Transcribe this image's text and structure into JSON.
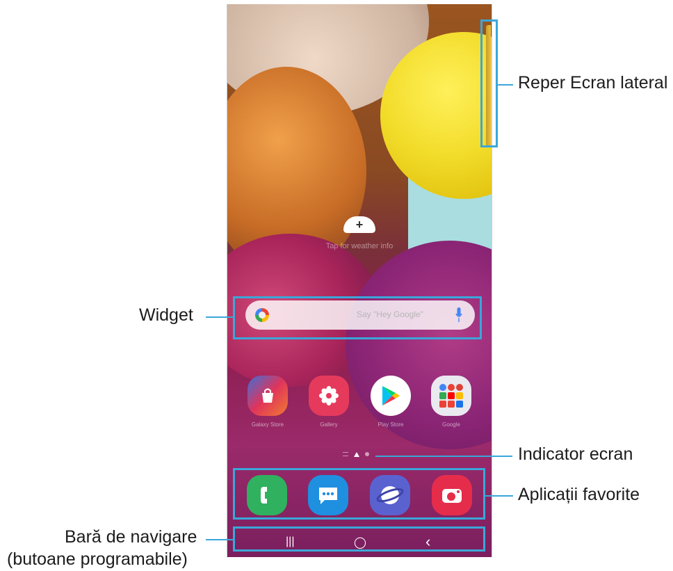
{
  "search_widget": {
    "hint": "Say \"Hey Google\""
  },
  "weather_widget": {
    "hint": "Tap for weather info"
  },
  "apps": [
    {
      "label": "Galaxy Store",
      "icon": "shopping-bag-icon",
      "color": "#e8434c"
    },
    {
      "label": "Gallery",
      "icon": "flower-icon",
      "color": "#e53a5c"
    },
    {
      "label": "Play Store",
      "icon": "play-triangle-icon",
      "color": "#ffffff"
    },
    {
      "label": "Google",
      "icon": "folder-icon",
      "color": "#e9e9ef"
    }
  ],
  "favorites": [
    {
      "icon": "phone-icon",
      "color": "#2fb15f"
    },
    {
      "icon": "messages-icon",
      "color": "#1f8fe0"
    },
    {
      "icon": "internet-icon",
      "color": "#5a62d0"
    },
    {
      "icon": "camera-icon",
      "color": "#e52d4b"
    }
  ],
  "nav": {
    "recents": "|||",
    "home": "◯",
    "back": "‹"
  },
  "callouts": {
    "edge_handle": "Reper Ecran lateral",
    "widget": "Widget",
    "page_indicator": "Indicator ecran",
    "favorite_apps": "Aplicații favorite",
    "nav_bar_line1": "Bară de navigare",
    "nav_bar_line2": "(butoane programabile)"
  },
  "accent_color": "#3aa7d9"
}
